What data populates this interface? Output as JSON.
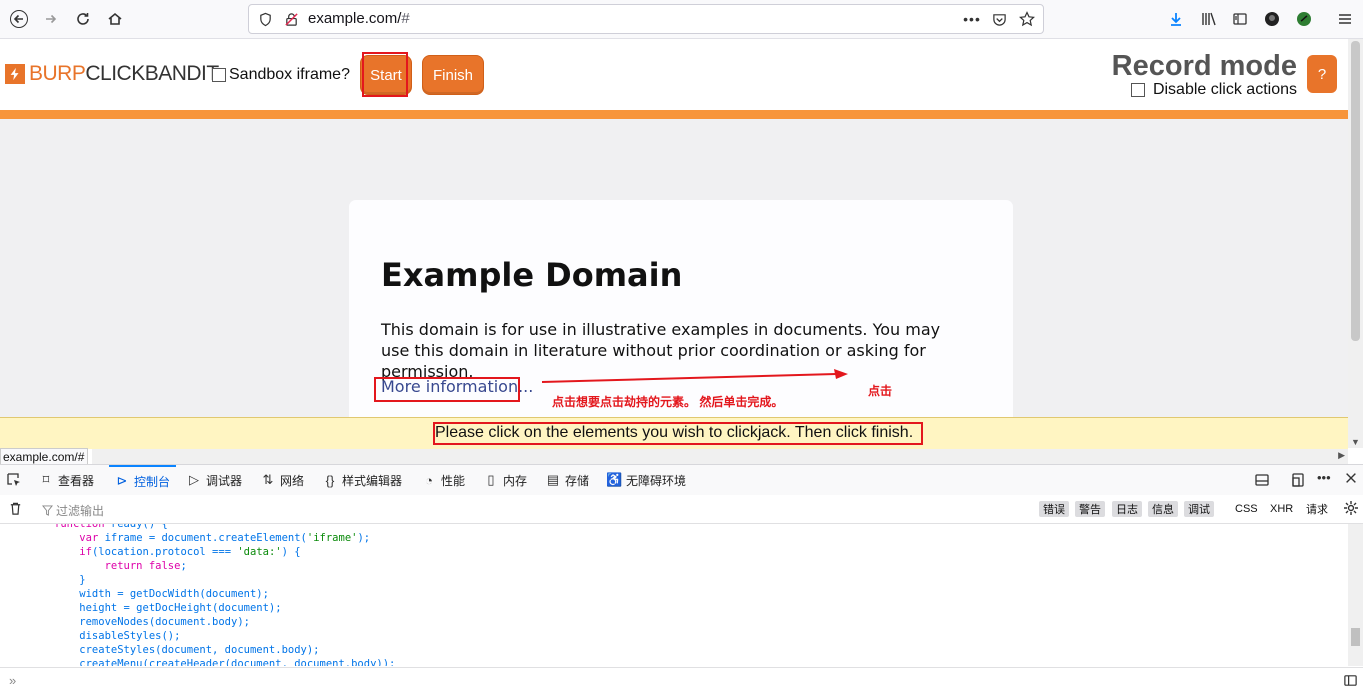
{
  "browser": {
    "url_host": "example.com/",
    "url_hash": "#",
    "status_url": "example.com/#"
  },
  "clickbandit": {
    "logo_burp": "BURP",
    "logo_clickbandit": "CLICKBANDIT",
    "sandbox_label": "Sandbox iframe?",
    "start_label": "Start",
    "finish_label": "Finish",
    "mode_title": "Record mode",
    "disable_click_label": "Disable click actions",
    "help_label": "?",
    "accent_color": "#e8742a"
  },
  "page": {
    "heading": "Example Domain",
    "paragraph": "This domain is for use in illustrative examples in documents. You may use this domain in literature without prior coordination or asking for permission.",
    "more_link": "More information..."
  },
  "annotations": {
    "instruction_cn": "点击想要点击劫持的元素。 然后单击完成。",
    "click_cn": "点击"
  },
  "notice": {
    "text": "Please click on the elements you wish to clickjack. Then click finish."
  },
  "devtools": {
    "tabs": [
      {
        "label": "查看器",
        "icon": "inspector-icon"
      },
      {
        "label": "控制台",
        "icon": "console-icon"
      },
      {
        "label": "调试器",
        "icon": "debugger-icon"
      },
      {
        "label": "网络",
        "icon": "network-icon"
      },
      {
        "label": "样式编辑器",
        "icon": "style-editor-icon"
      },
      {
        "label": "性能",
        "icon": "performance-icon"
      },
      {
        "label": "内存",
        "icon": "memory-icon"
      },
      {
        "label": "存储",
        "icon": "storage-icon"
      },
      {
        "label": "无障碍环境",
        "icon": "accessibility-icon"
      }
    ],
    "filter_placeholder": "过滤输出",
    "filter_buttons": [
      "错误",
      "警告",
      "日志",
      "信息",
      "调试",
      "CSS",
      "XHR",
      "请求"
    ],
    "code_lines": [
      "function ready() {",
      "    var iframe = document.createElement('iframe');",
      "    if(location.protocol === 'data:') {",
      "        return false;",
      "    }",
      "    width = getDocWidth(document);",
      "    height = getDocHeight(document);",
      "    removeNodes(document.body);",
      "    disableStyles();",
      "    createStyles(document, document.body);",
      "    createMenu(createHeader(document, document.body));"
    ]
  }
}
